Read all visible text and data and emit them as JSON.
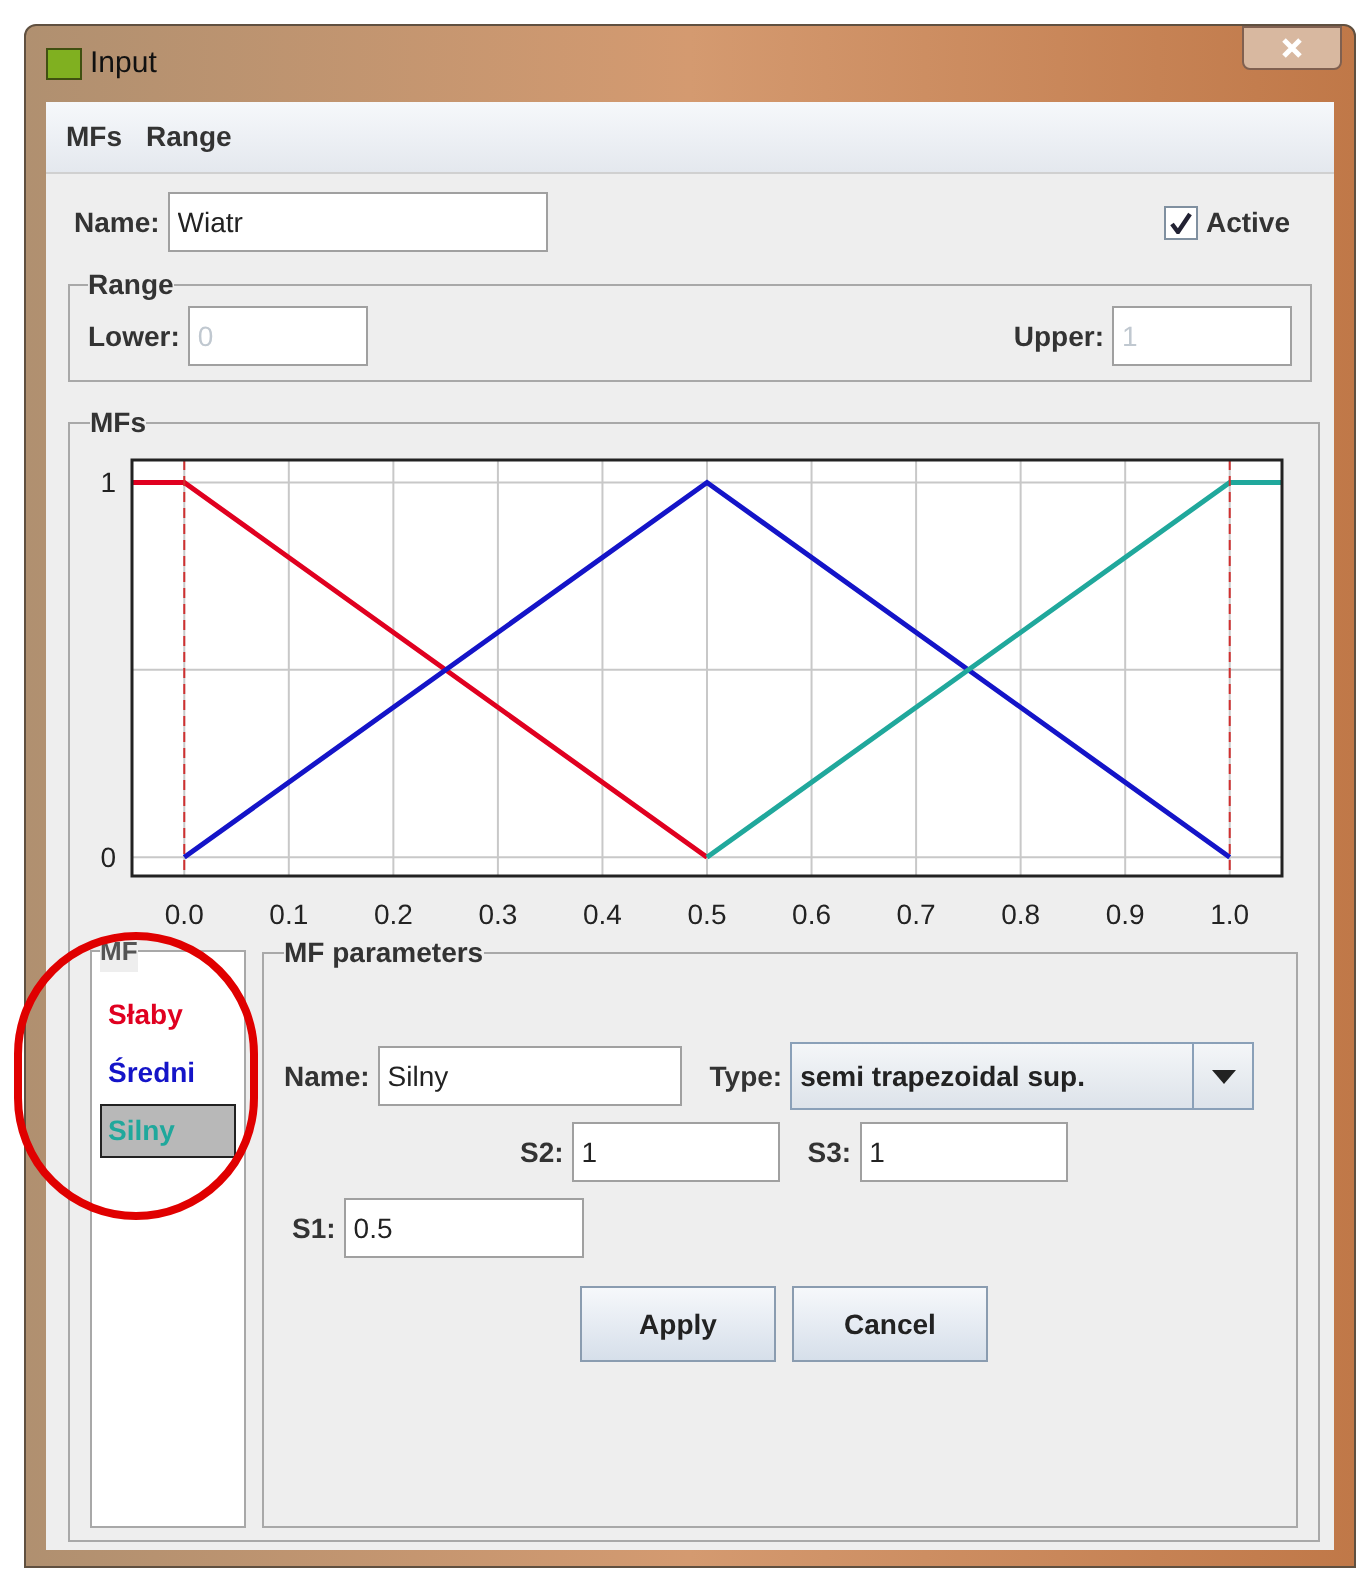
{
  "window": {
    "title": "Input"
  },
  "menu": [
    {
      "label": "MFs"
    },
    {
      "label": "Range"
    }
  ],
  "name_field": {
    "label": "Name:",
    "value": "Wiatr"
  },
  "active": {
    "label": "Active",
    "checked": true
  },
  "range": {
    "title": "Range",
    "lower": {
      "label": "Lower:",
      "value": "0",
      "disabled": true
    },
    "upper": {
      "label": "Upper:",
      "value": "1",
      "disabled": true
    }
  },
  "mfs": {
    "title": "MFs",
    "chart_data": {
      "type": "line",
      "x": [
        -0.05,
        0,
        0.5,
        1,
        1.05
      ],
      "xlim": [
        -0.05,
        1.05
      ],
      "ylim": [
        -0.05,
        1.06
      ],
      "xticks": [
        {
          "value": 0,
          "label": "0.0"
        },
        {
          "value": 0.1,
          "label": "0.1"
        },
        {
          "value": 0.2,
          "label": "0.2"
        },
        {
          "value": 0.3,
          "label": "0.3"
        },
        {
          "value": 0.4,
          "label": "0.4"
        },
        {
          "value": 0.5,
          "label": "0.5"
        },
        {
          "value": 0.6,
          "label": "0.6"
        },
        {
          "value": 0.7,
          "label": "0.7"
        },
        {
          "value": 0.8,
          "label": "0.8"
        },
        {
          "value": 0.9,
          "label": "0.9"
        },
        {
          "value": 1,
          "label": "1.0"
        }
      ],
      "yticks": [
        0,
        1
      ],
      "series": [
        {
          "color": "#e00020",
          "values": [
            1,
            1,
            0,
            null,
            null
          ]
        },
        {
          "color": "#1414c8",
          "values": [
            null,
            0,
            1,
            0,
            null
          ]
        },
        {
          "color": "#20a89c",
          "values": [
            null,
            null,
            0,
            1,
            1
          ]
        }
      ],
      "grid": true
    }
  },
  "mf_list": {
    "title": "MF",
    "items": [
      {
        "label": "Słaby",
        "color": "#e00020",
        "selected": false
      },
      {
        "label": "Średni",
        "color": "#1414c8",
        "selected": false
      },
      {
        "label": "Silny",
        "color": "#20a89c",
        "selected": true
      }
    ]
  },
  "mf_parameters": {
    "title": "MF parameters",
    "name": {
      "label": "Name:",
      "value": "Silny"
    },
    "type": {
      "label": "Type:",
      "value": "semi trapezoidal sup."
    },
    "s2": {
      "label": "S2:",
      "value": "1"
    },
    "s3": {
      "label": "S3:",
      "value": "1"
    },
    "s1": {
      "label": "S1:",
      "value": "0.5"
    }
  },
  "buttons": [
    {
      "label": "Apply"
    },
    {
      "label": "Cancel"
    }
  ]
}
